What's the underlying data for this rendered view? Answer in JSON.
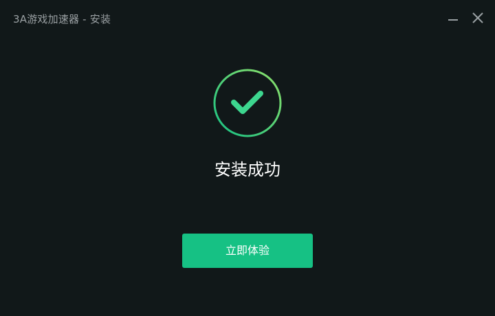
{
  "window": {
    "title": "3A游戏加速器 - 安装"
  },
  "controls": {
    "minimize_icon": "minimize-icon",
    "close_icon": "close-icon"
  },
  "status": {
    "icon": "check-circle-icon",
    "message": "安装成功"
  },
  "actions": {
    "primary_label": "立即体验"
  },
  "colors": {
    "background": "#111819",
    "title_text": "#9aa0a3",
    "accent_green": "#16c184",
    "ring_gradient_start": "#8fe06a",
    "ring_gradient_end": "#16c184",
    "check": "#3dd68f"
  }
}
